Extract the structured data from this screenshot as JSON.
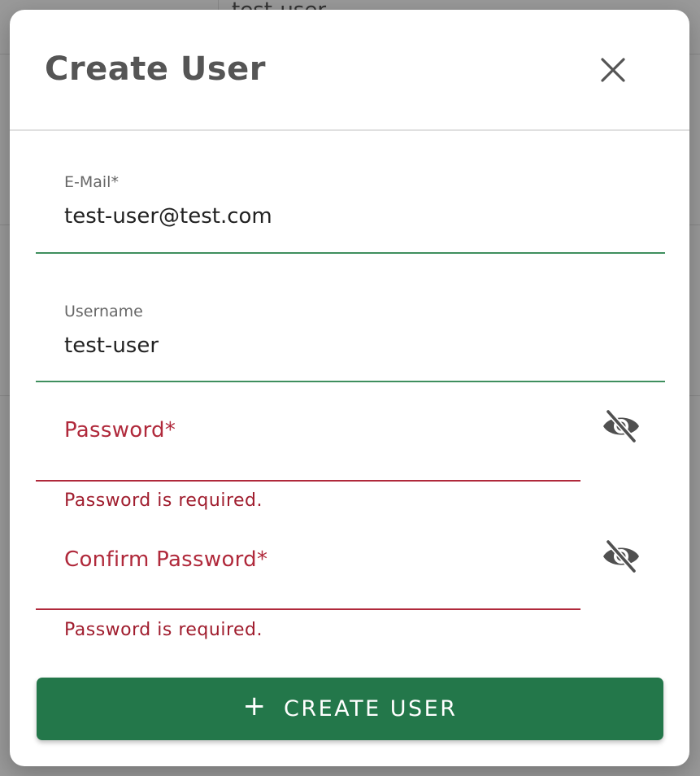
{
  "background": {
    "row_text": "test-user"
  },
  "dialog": {
    "title": "Create User",
    "close_icon": "close-icon"
  },
  "form": {
    "email": {
      "label": "E-Mail*",
      "value": "test-user@test.com"
    },
    "username": {
      "label": "Username",
      "value": "test-user"
    },
    "password": {
      "label": "Password*",
      "value": "",
      "error": "Password is required.",
      "toggle_icon": "eye-off-icon"
    },
    "confirm_password": {
      "label": "Confirm Password*",
      "value": "",
      "error": "Password is required.",
      "toggle_icon": "eye-off-icon"
    }
  },
  "submit": {
    "icon": "plus-icon",
    "label": "CREATE USER"
  },
  "colors": {
    "primary": "#23774a",
    "valid_underline": "#3f8f5e",
    "error": "#b0293b",
    "title": "#555555"
  }
}
